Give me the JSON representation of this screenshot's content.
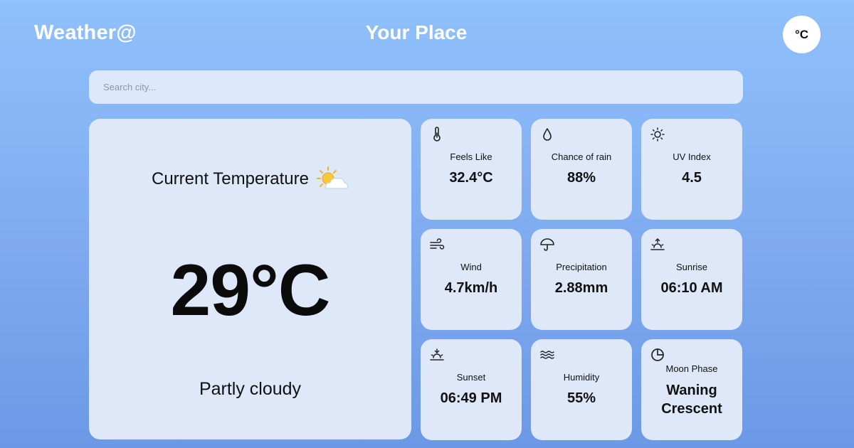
{
  "header": {
    "brand": "Weather@",
    "location": "Your Place",
    "unit_toggle": "°C"
  },
  "search": {
    "placeholder": "Search city..."
  },
  "current": {
    "title": "Current Temperature",
    "icon": "sun-behind-cloud-icon",
    "temperature": "29°C",
    "condition": "Partly cloudy"
  },
  "tiles": [
    {
      "label": "Feels Like",
      "value": "32.4°C",
      "icon": "thermometer-icon"
    },
    {
      "label": "Chance of rain",
      "value": "88%",
      "icon": "droplet-icon"
    },
    {
      "label": "UV Index",
      "value": "4.5",
      "icon": "sun-icon"
    },
    {
      "label": "Wind",
      "value": "4.7km/h",
      "icon": "wind-icon"
    },
    {
      "label": "Precipitation",
      "value": "2.88mm",
      "icon": "umbrella-icon"
    },
    {
      "label": "Sunrise",
      "value": "06:10 AM",
      "icon": "sunrise-icon"
    },
    {
      "label": "Sunset",
      "value": "06:49 PM",
      "icon": "sunset-icon"
    },
    {
      "label": "Humidity",
      "value": "55%",
      "icon": "waves-icon"
    },
    {
      "label": "Moon Phase",
      "value": "Waning Crescent",
      "icon": "moon-phase-icon"
    }
  ]
}
